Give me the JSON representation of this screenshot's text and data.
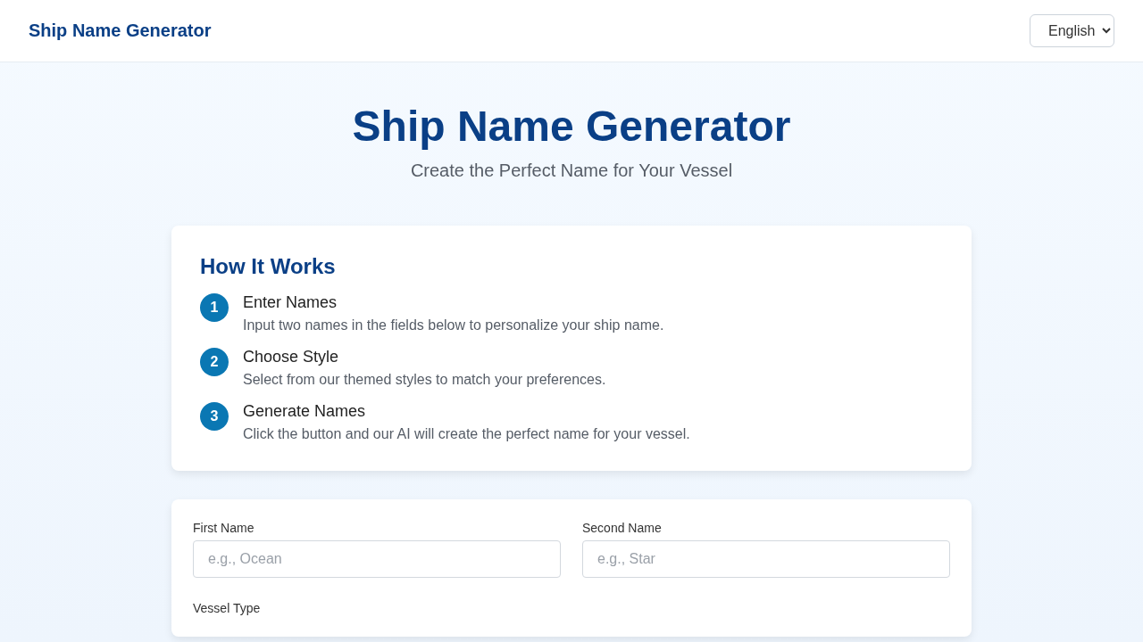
{
  "header": {
    "brand": "Ship Name Generator",
    "language": "English"
  },
  "hero": {
    "title": "Ship Name Generator",
    "subtitle": "Create the Perfect Name for Your Vessel"
  },
  "how_it_works": {
    "title": "How It Works",
    "steps": [
      {
        "number": "1",
        "title": "Enter Names",
        "description": "Input two names in the fields below to personalize your ship name."
      },
      {
        "number": "2",
        "title": "Choose Style",
        "description": "Select from our themed styles to match your preferences."
      },
      {
        "number": "3",
        "title": "Generate Names",
        "description": "Click the button and our AI will create the perfect name for your vessel."
      }
    ]
  },
  "form": {
    "fields": [
      {
        "label": "First Name",
        "placeholder": "e.g., Ocean"
      },
      {
        "label": "Second Name",
        "placeholder": "e.g., Star"
      }
    ],
    "vessel_type_label": "Vessel Type"
  }
}
